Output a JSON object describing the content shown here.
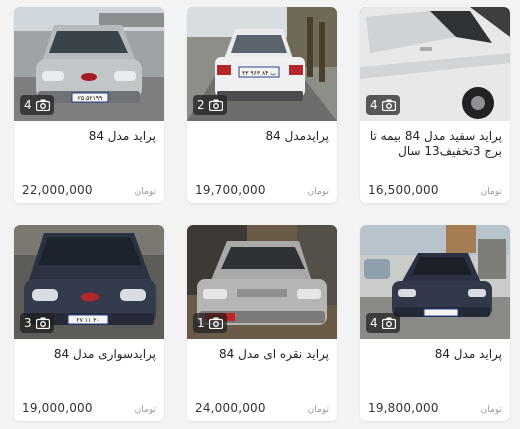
{
  "listings": [
    {
      "title": "پراید مدل 84",
      "price": "22,000,000",
      "currency": "تومان",
      "photo_count": "4",
      "plate": "۲۵ ۵۲۱۹۹"
    },
    {
      "title": "پرایدمدل 84",
      "price": "19,700,000",
      "currency": "تومان",
      "photo_count": "2",
      "plate": "۳۳ ۹۶۳ ب ۸۴"
    },
    {
      "title": "پراید سفید مدل 84 بیمه تا برج 3تخفیف13 سال",
      "price": "16,500,000",
      "currency": "تومان",
      "photo_count": "4",
      "plate": ""
    },
    {
      "title": "پرایدسواری مدل 84",
      "price": "19,000,000",
      "currency": "تومان",
      "photo_count": "3",
      "plate": "۲۷ ۱۱ ۳۰"
    },
    {
      "title": "پراید نقره ای مدل 84",
      "price": "24,000,000",
      "currency": "تومان",
      "photo_count": "1",
      "plate": ""
    },
    {
      "title": "پراید مدل 84",
      "price": "19,800,000",
      "currency": "تومان",
      "photo_count": "4",
      "plate": ""
    }
  ],
  "colors": {
    "background": "#f3f3f3",
    "card": "#ffffff",
    "badge": "#2b2b2b",
    "currency": "#9a9a9a"
  },
  "icons": {
    "photo_badge": "camera-icon"
  }
}
